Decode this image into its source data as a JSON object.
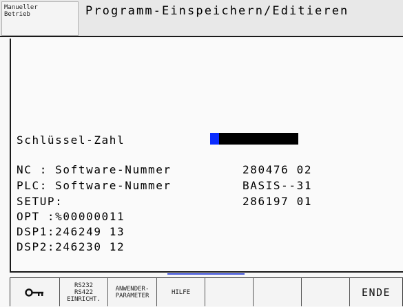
{
  "header": {
    "mode_label": "Manueller\nBetrieb",
    "title": "Programm-Einspeichern/Editieren"
  },
  "password": {
    "label": "Schlüssel-Zahl",
    "value": ""
  },
  "info": [
    {
      "label": "NC : Software-Nummer",
      "value": "280476 02"
    },
    {
      "label": "PLC: Software-Nummer",
      "value": "BASIS--31"
    },
    {
      "label": "SETUP:",
      "value": "286197 01"
    },
    {
      "label": "OPT :%00000011",
      "value": ""
    },
    {
      "label": "DSP1:246249 13",
      "value": ""
    },
    {
      "label": "DSP2:246230 12",
      "value": ""
    }
  ],
  "softkeys": [
    {
      "label": "",
      "icon": "key-icon"
    },
    {
      "label": "RS232\nRS422\nEINRICHT."
    },
    {
      "label": "ANWENDER-\nPARAMETER"
    },
    {
      "label": "HILFE"
    },
    {
      "label": ""
    },
    {
      "label": ""
    },
    {
      "label": ""
    },
    {
      "label": "ENDE"
    }
  ],
  "colors": {
    "cursor": "#0a2cff",
    "input_field": "#000000",
    "scroll_indicator": "#3b4fd8"
  }
}
